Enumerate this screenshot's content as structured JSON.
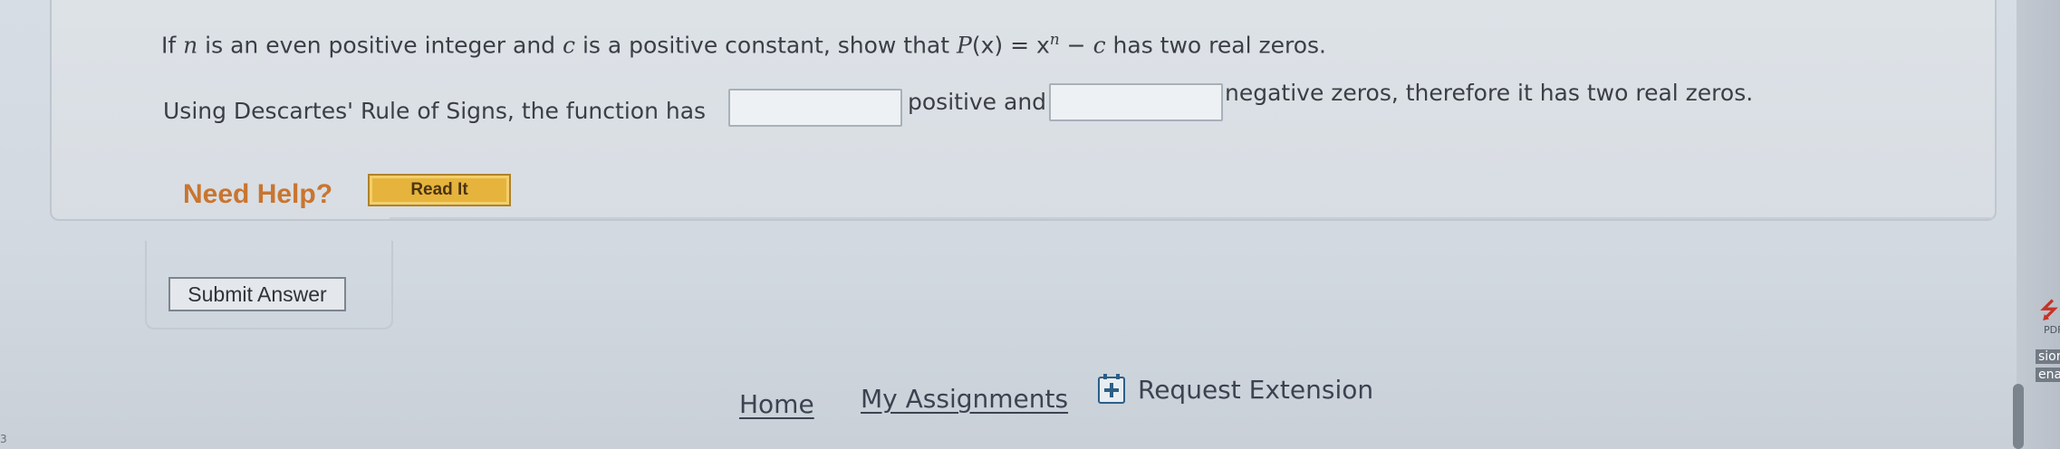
{
  "question": {
    "prefix": "If ",
    "n": "n",
    "mid1": " is an even positive integer and ",
    "c": "c",
    "mid2": " is a positive constant, show that ",
    "P": "P",
    "x_arg": "(x) = x",
    "exp": "n",
    "minus": " − ",
    "c2": "c",
    "suffix": " has two real zeros."
  },
  "answer_row": {
    "text1": "Using Descartes' Rule of Signs, the function has",
    "input1_value": "",
    "text2": "positive and",
    "input2_value": "",
    "text3": "negative zeros, therefore it has two real zeros."
  },
  "help": {
    "label": "Need Help?",
    "read_it": "Read It"
  },
  "submit_label": "Submit Answer",
  "footer": {
    "home": "Home",
    "assignments": "My Assignments",
    "extension": "Request Extension"
  },
  "side": {
    "pdf_text": "PDF",
    "cut1": "sior",
    "cut2": "ena",
    "left_tick": "3"
  },
  "colors": {
    "need_help": "#c9752f",
    "read_it_bg": "#e6b43c",
    "extension_icon": "#2b5f86",
    "pdf_red": "#c63325"
  }
}
